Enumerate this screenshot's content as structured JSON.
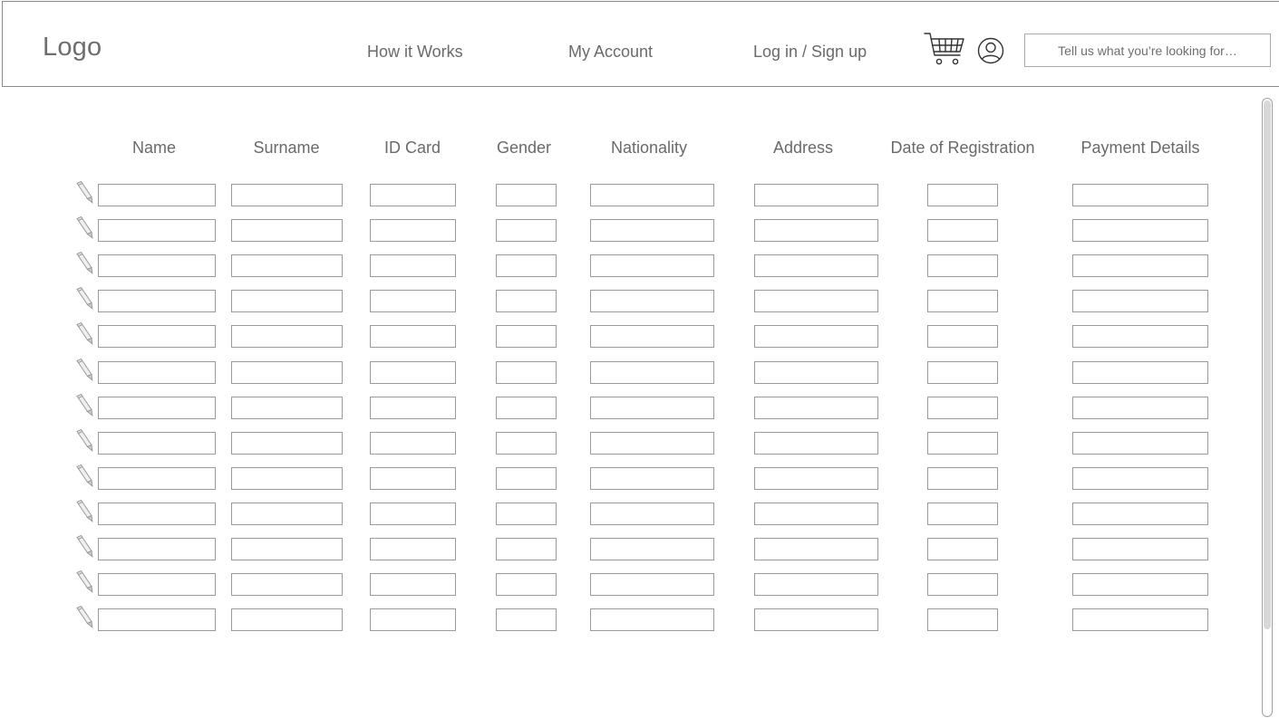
{
  "header": {
    "logo": "Logo",
    "nav": [
      {
        "label": "How it Works"
      },
      {
        "label": "My Account"
      },
      {
        "label": "Log in / Sign up"
      }
    ],
    "cart_icon": "cart-icon",
    "user_icon": "user-circle-icon",
    "search": {
      "value": "",
      "placeholder": "Tell us what you’re looking for…"
    }
  },
  "table": {
    "columns": [
      "Name",
      "Surname",
      "ID Card",
      "Gender",
      "Nationality",
      "Address",
      "Date of Registration",
      "Payment Details"
    ],
    "row_icon": "pencil-icon",
    "rows": [
      [
        "",
        "",
        "",
        "",
        "",
        "",
        "",
        ""
      ],
      [
        "",
        "",
        "",
        "",
        "",
        "",
        "",
        ""
      ],
      [
        "",
        "",
        "",
        "",
        "",
        "",
        "",
        ""
      ],
      [
        "",
        "",
        "",
        "",
        "",
        "",
        "",
        ""
      ],
      [
        "",
        "",
        "",
        "",
        "",
        "",
        "",
        ""
      ],
      [
        "",
        "",
        "",
        "",
        "",
        "",
        "",
        ""
      ],
      [
        "",
        "",
        "",
        "",
        "",
        "",
        "",
        ""
      ],
      [
        "",
        "",
        "",
        "",
        "",
        "",
        "",
        ""
      ],
      [
        "",
        "",
        "",
        "",
        "",
        "",
        "",
        ""
      ],
      [
        "",
        "",
        "",
        "",
        "",
        "",
        "",
        ""
      ],
      [
        "",
        "",
        "",
        "",
        "",
        "",
        "",
        ""
      ],
      [
        "",
        "",
        "",
        "",
        "",
        "",
        "",
        ""
      ],
      [
        "",
        "",
        "",
        "",
        "",
        "",
        "",
        ""
      ]
    ]
  },
  "colors": {
    "border": "#9a9a9a",
    "text": "#6a6a6a"
  }
}
